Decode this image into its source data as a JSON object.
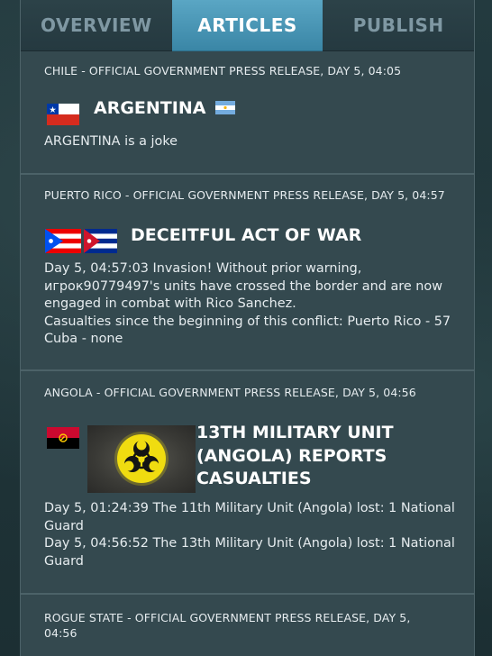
{
  "tabs": [
    {
      "label": "OVERVIEW"
    },
    {
      "label": "ARTICLES"
    },
    {
      "label": "PUBLISH"
    }
  ],
  "articles": [
    {
      "meta": "CHILE - OFFICIAL GOVERNMENT PRESS RELEASE, DAY 5, 04:05",
      "headline": "ARGENTINA",
      "body": [
        "ARGENTINA is a joke"
      ]
    },
    {
      "meta": "PUERTO RICO - OFFICIAL GOVERNMENT PRESS RELEASE, DAY 5, 04:57",
      "headline": "DECEITFUL ACT OF WAR",
      "body": [
        "Day 5, 04:57:03 Invasion! Without prior warning, игрок90779497's units have crossed the border and are now engaged in combat with Rico Sanchez.",
        "Casualties since the beginning of this conflict: Puerto Rico - 57 Cuba - none"
      ]
    },
    {
      "meta": "ANGOLA - OFFICIAL GOVERNMENT PRESS RELEASE, DAY 5, 04:56",
      "headline": "13TH MILITARY UNIT (ANGOLA) REPORTS CASUALTIES",
      "body": [
        "Day 5, 01:24:39 The 11th Military Unit (Angola) lost: 1 National Guard",
        "Day 5, 04:56:52 The 13th Military Unit (Angola) lost: 1 National Guard"
      ]
    },
    {
      "meta": "ROGUE STATE - OFFICIAL GOVERNMENT PRESS RELEASE, DAY 5, 04:56"
    }
  ],
  "icons": {
    "chile": "chile-flag-icon",
    "argentina": "argentina-flag-icon",
    "puerto_rico": "puerto-rico-flag-icon",
    "cuba": "cuba-flag-icon",
    "angola": "angola-flag-icon",
    "biohazard": "biohazard-icon"
  }
}
